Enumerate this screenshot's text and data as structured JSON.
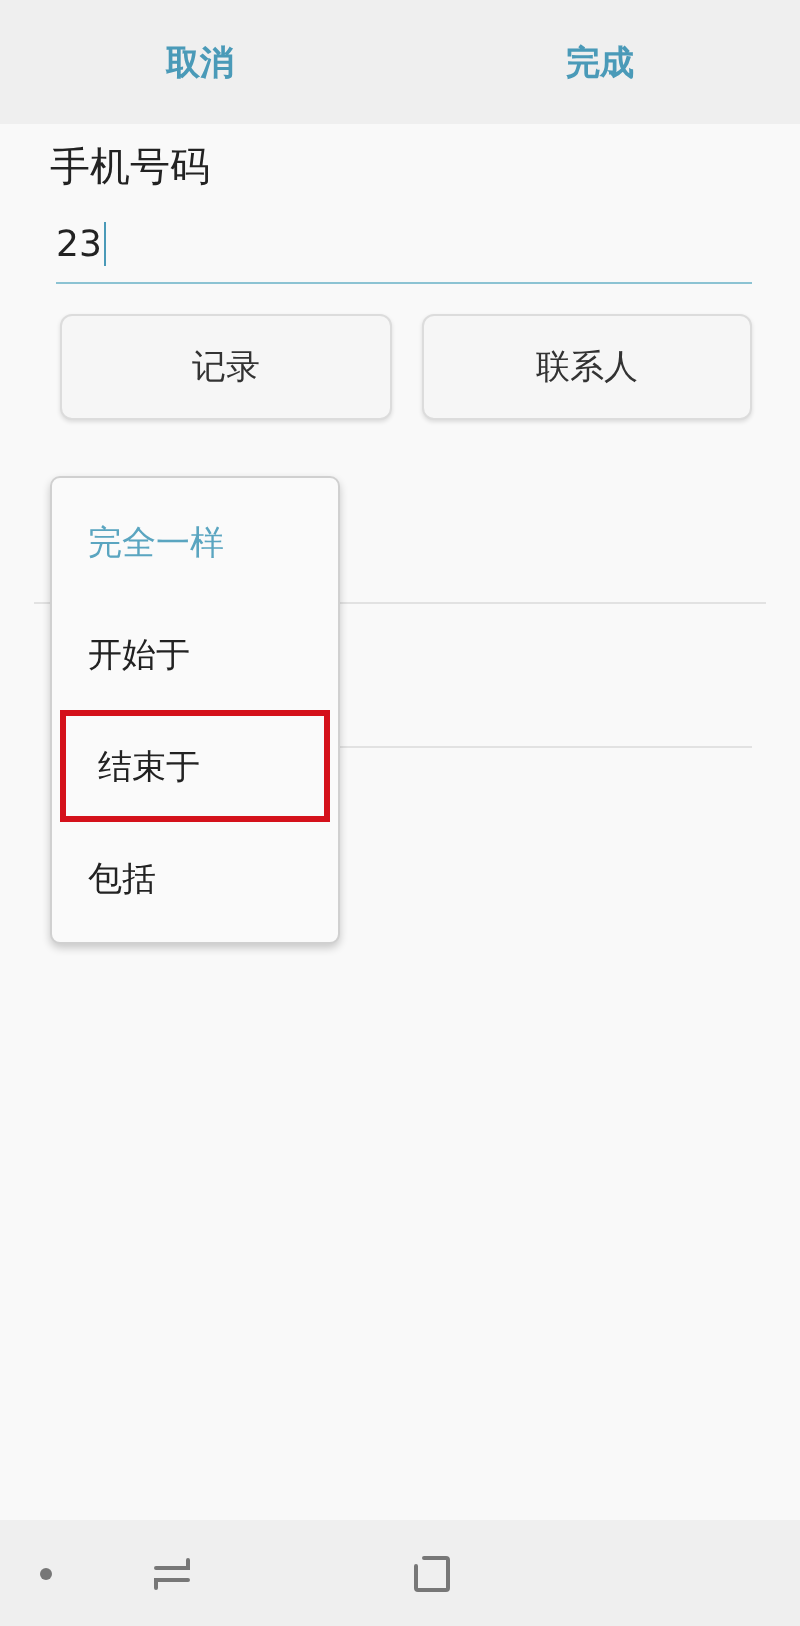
{
  "top_bar": {
    "cancel": "取消",
    "done": "完成"
  },
  "field": {
    "label": "手机号码",
    "value": "23"
  },
  "buttons": [
    "记录",
    "联系人"
  ],
  "menu": [
    {
      "label": "完全一样",
      "selected": true,
      "highlighted": false
    },
    {
      "label": "开始于",
      "selected": false,
      "highlighted": false
    },
    {
      "label": "结束于",
      "selected": false,
      "highlighted": true
    },
    {
      "label": "包括",
      "selected": false,
      "highlighted": false
    }
  ]
}
